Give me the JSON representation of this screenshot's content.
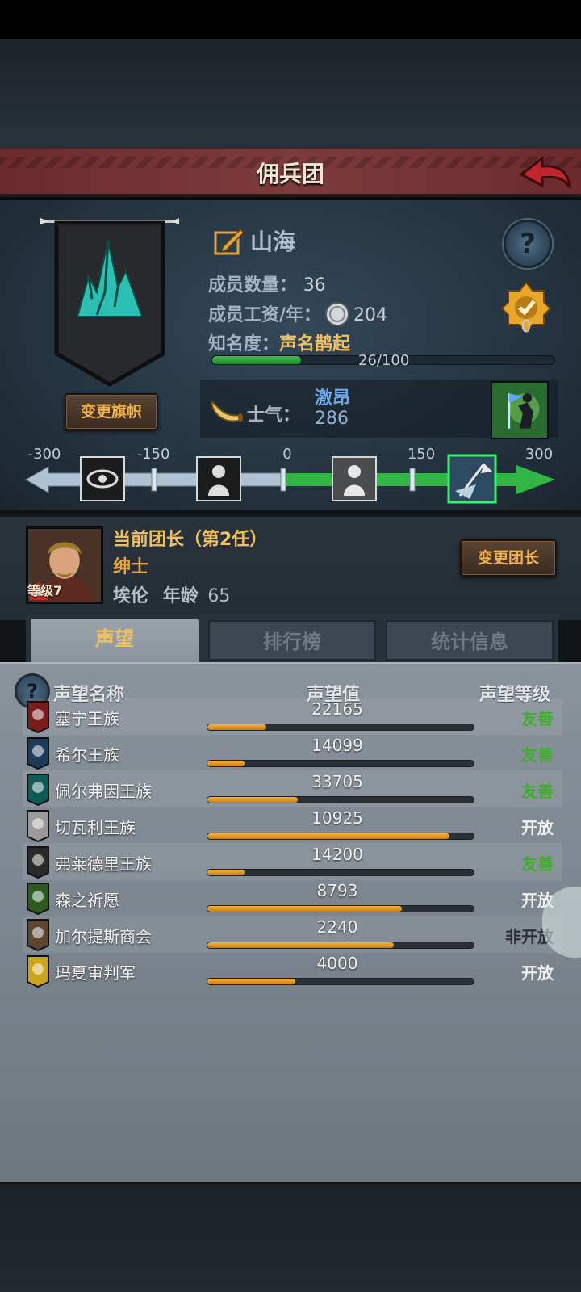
{
  "header": {
    "title": "佣兵团"
  },
  "guild": {
    "name": "山海",
    "members_label": "成员数量：",
    "members_value": "36",
    "salary_label": "成员工资/年：",
    "salary_value": "204",
    "fame_label": "知名度：",
    "fame_level": "声名鹊起",
    "fame_progress_text": "26/100",
    "fame_progress": 0.26,
    "badge_count": "0",
    "change_banner_label": "变更旗帜"
  },
  "morale": {
    "label": "士气：",
    "state": "激昂",
    "value": "286",
    "ticks": [
      "-300",
      "-150",
      "0",
      "150",
      "300"
    ]
  },
  "leader": {
    "heading": "当前团长（第2任）",
    "title": "绅士",
    "name": "埃伦",
    "age_label": "年龄",
    "age": "65",
    "level": "等级7",
    "change_label": "变更团长"
  },
  "tabs": [
    "声望",
    "排行榜",
    "统计信息"
  ],
  "reputation": {
    "columns": [
      "声望名称",
      "声望值",
      "声望等级"
    ],
    "rows": [
      {
        "name": "塞宁王族",
        "value": "22165",
        "fill": 0.22,
        "level": "友善",
        "level_color": "#3fae2e",
        "flag_color": "#7a1c1c",
        "icon": "red-crest-icon"
      },
      {
        "name": "希尔王族",
        "value": "14099",
        "fill": 0.14,
        "level": "友善",
        "level_color": "#3fae2e",
        "flag_color": "#1e3a5a",
        "icon": "blue-skull-icon"
      },
      {
        "name": "佩尔弗因王族",
        "value": "33705",
        "fill": 0.34,
        "level": "友善",
        "level_color": "#3fae2e",
        "flag_color": "#0f5a56",
        "icon": "teal-moon-icon"
      },
      {
        "name": "切瓦利王族",
        "value": "10925",
        "fill": 0.91,
        "level": "开放",
        "level_color": "#f2f2f2",
        "flag_color": "#9a9a9a",
        "icon": "scales-icon"
      },
      {
        "name": "弗莱德里王族",
        "value": "14200",
        "fill": 0.14,
        "level": "友善",
        "level_color": "#3fae2e",
        "flag_color": "#2a2a2a",
        "icon": "wolf-icon"
      },
      {
        "name": "森之祈愿",
        "value": "8793",
        "fill": 0.73,
        "level": "开放",
        "level_color": "#f2f2f2",
        "flag_color": "#2e5a22",
        "icon": "tree-icon"
      },
      {
        "name": "加尔提斯商会",
        "value": "2240",
        "fill": 0.7,
        "level": "非开放",
        "level_color": "#2a3038",
        "flag_color": "#5a4632",
        "icon": "chest-icon"
      },
      {
        "name": "玛夏审判军",
        "value": "4000",
        "fill": 0.33,
        "level": "开放",
        "level_color": "#f2f2f2",
        "flag_color": "#c9a51a",
        "icon": "sun-icon"
      }
    ]
  }
}
